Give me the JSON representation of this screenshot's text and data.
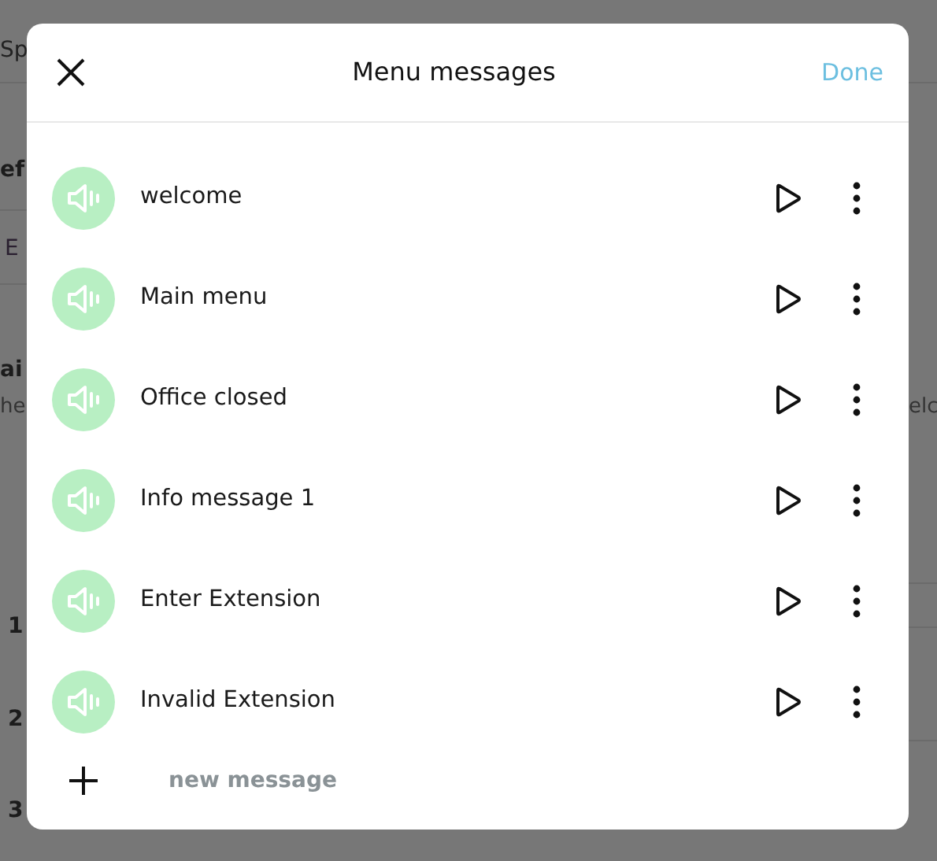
{
  "background": {
    "left": [
      {
        "kind": "tab",
        "text": "Sp"
      },
      {
        "kind": "heading",
        "text": "ef"
      },
      {
        "kind": "field",
        "text": "E"
      },
      {
        "kind": "heading",
        "text": "ai"
      },
      {
        "kind": "hint",
        "text": "he"
      },
      {
        "kind": "step",
        "text": "1"
      },
      {
        "kind": "step",
        "text": "2"
      },
      {
        "kind": "step",
        "text": "3"
      }
    ],
    "right": {
      "text": "elc"
    }
  },
  "dialog": {
    "title": "Menu messages",
    "done": "Done",
    "messages": [
      {
        "name": "welcome"
      },
      {
        "name": "Main menu"
      },
      {
        "name": "Office closed"
      },
      {
        "name": "Info message 1"
      },
      {
        "name": "Enter Extension"
      },
      {
        "name": "Invalid Extension"
      }
    ],
    "new_message": "new message"
  }
}
